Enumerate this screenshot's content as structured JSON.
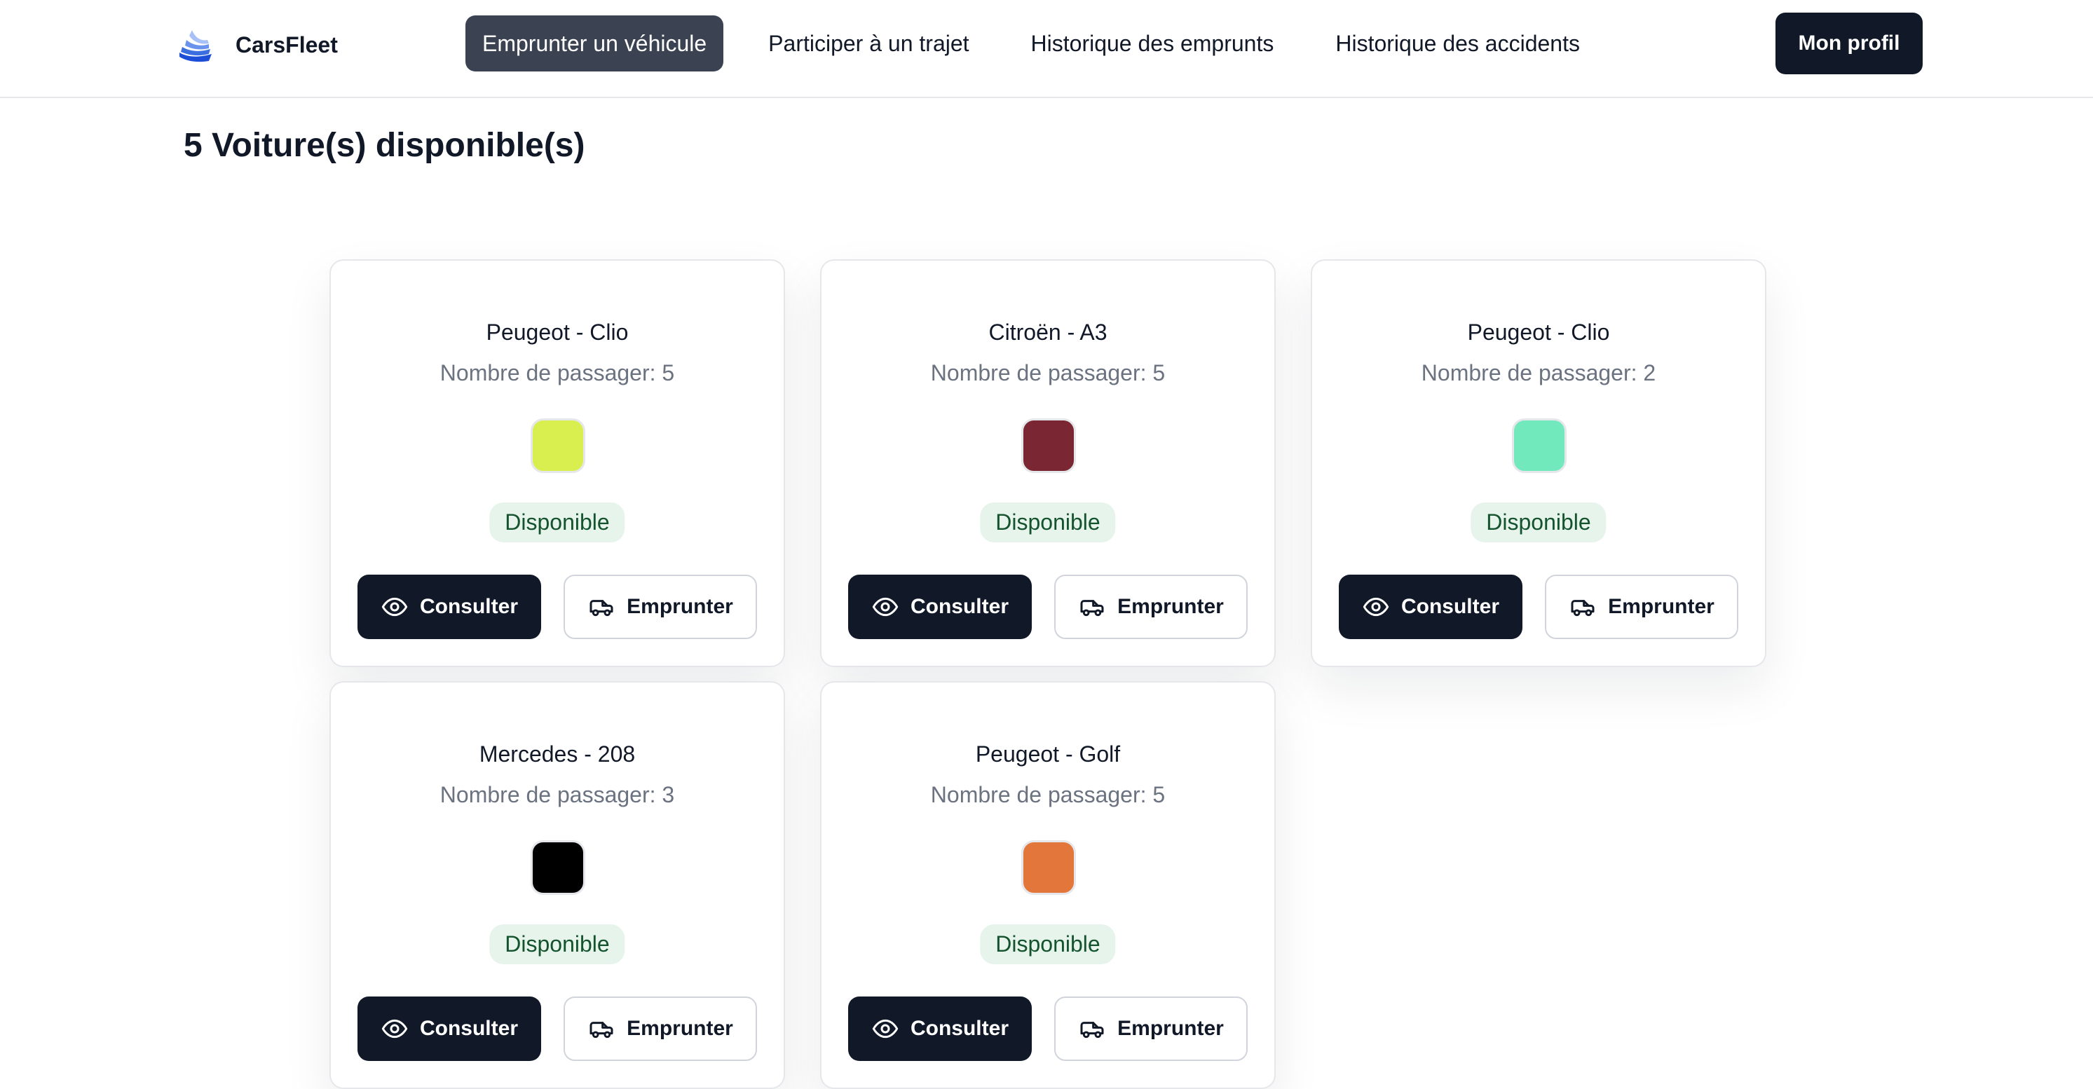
{
  "brand": {
    "name": "CarsFleet"
  },
  "nav": [
    {
      "label": "Emprunter un véhicule",
      "active": true
    },
    {
      "label": "Participer à un trajet",
      "active": false
    },
    {
      "label": "Historique des emprunts",
      "active": false
    },
    {
      "label": "Historique des accidents",
      "active": false
    }
  ],
  "profile": {
    "label": "Mon profil"
  },
  "page": {
    "title": "5 Voiture(s) disponible(s)"
  },
  "labels": {
    "passengers": "Nombre de passager: ",
    "consult": "Consulter",
    "borrow": "Emprunter"
  },
  "cars": [
    {
      "model": "Peugeot - Clio",
      "passengers": "5",
      "color": "#d9ef4f",
      "status": "Disponible"
    },
    {
      "model": "Citroën - A3",
      "passengers": "5",
      "color": "#7a2733",
      "status": "Disponible"
    },
    {
      "model": "Peugeot - Clio",
      "passengers": "2",
      "color": "#72e8bd",
      "status": "Disponible"
    },
    {
      "model": "Mercedes - 208",
      "passengers": "3",
      "color": "#000000",
      "status": "Disponible"
    },
    {
      "model": "Peugeot - Golf",
      "passengers": "5",
      "color": "#e3763a",
      "status": "Disponible"
    }
  ],
  "icons": {
    "logo": "stacked-layers-logo",
    "consult": "eye-icon",
    "borrow": "car-icon"
  },
  "colors": {
    "primary": "#111827",
    "active_nav": "#3b4252",
    "badge_bg": "#e6f4ec",
    "badge_text": "#14532d"
  }
}
